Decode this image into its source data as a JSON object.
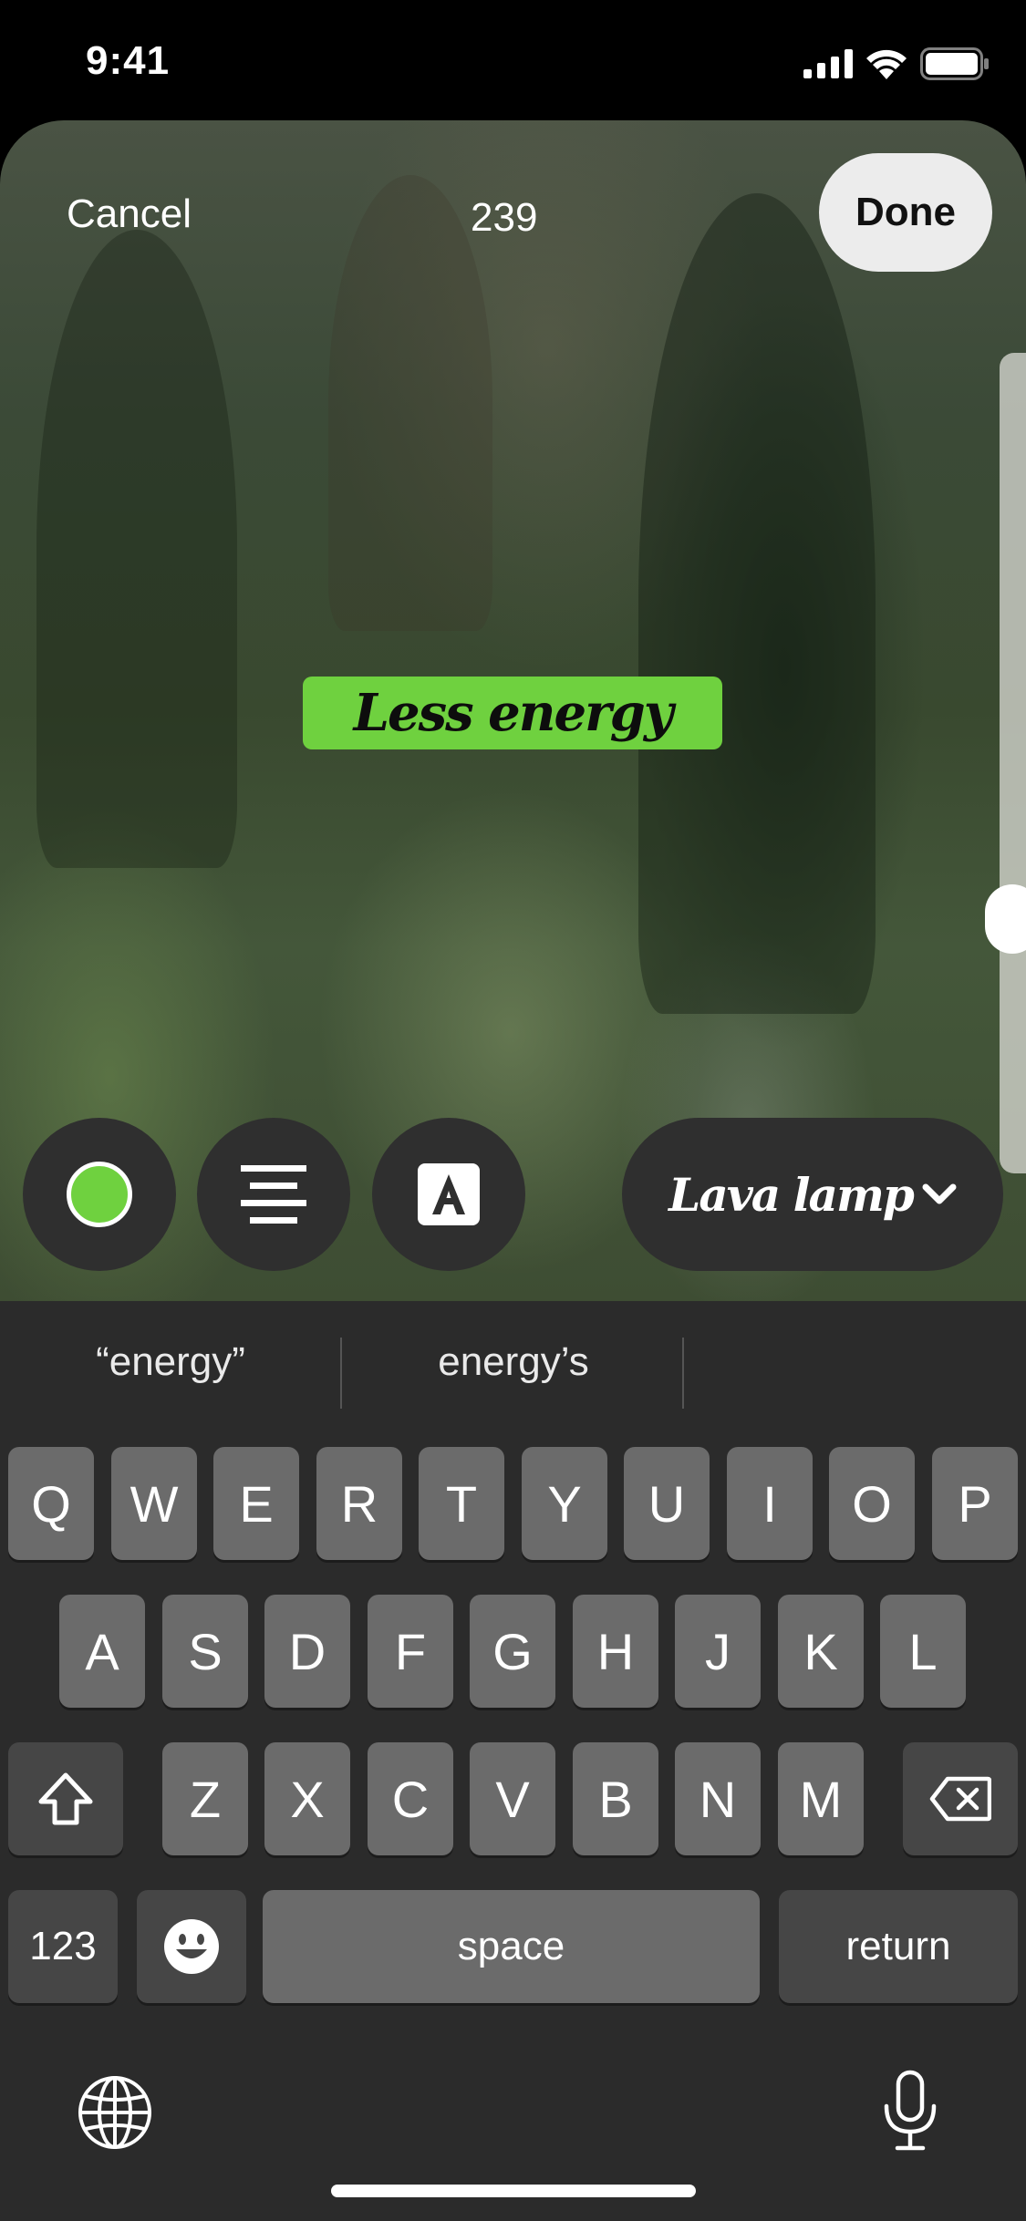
{
  "status_bar": {
    "time": "9:41"
  },
  "editor": {
    "cancel_label": "Cancel",
    "char_counter": "239",
    "done_label": "Done",
    "caption_text": "Less energy",
    "caption_bg_color": "#6fd13f",
    "font_selector_label": "Lava lamp"
  },
  "keyboard": {
    "suggestions": [
      "“energy”",
      "energy’s"
    ],
    "row1": [
      "Q",
      "W",
      "E",
      "R",
      "T",
      "Y",
      "U",
      "I",
      "O",
      "P"
    ],
    "row2": [
      "A",
      "S",
      "D",
      "F",
      "G",
      "H",
      "J",
      "K",
      "L"
    ],
    "row3": [
      "Z",
      "X",
      "C",
      "V",
      "B",
      "N",
      "M"
    ],
    "numbers_label": "123",
    "space_label": "space",
    "return_label": "return"
  }
}
